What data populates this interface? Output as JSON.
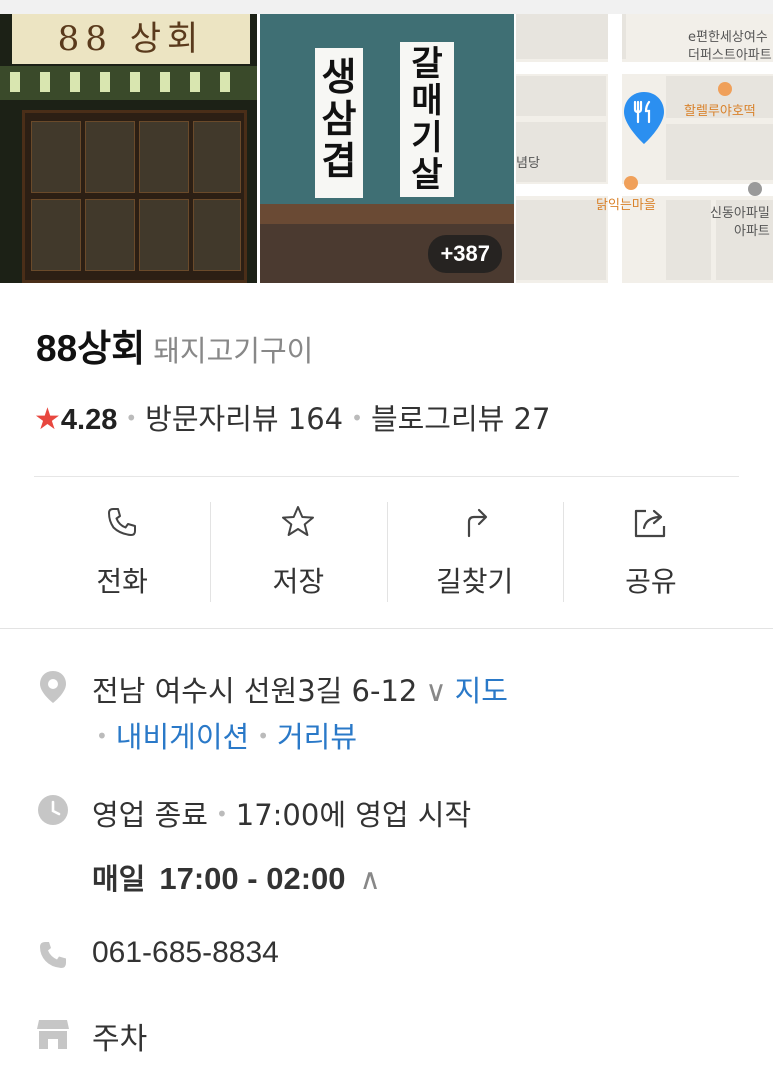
{
  "photos": {
    "store_sign_text": "88 상회",
    "banner_left_text": "생삼겹",
    "banner_right_text": "갈매기살",
    "more_count": "+387",
    "map_labels": {
      "top_right_1": "e편한세상여수",
      "top_right_2": "더퍼스트아파트",
      "orange_1": "할렐루야호떡",
      "left_edge": "념당",
      "orange_2": "닭익는마을",
      "right_1": "신동아파밀",
      "right_2": "아파트"
    }
  },
  "place": {
    "name": "88상회",
    "category": "돼지고기구이",
    "rating": "4.28",
    "visitor_reviews": "방문자리뷰 164",
    "blog_reviews": "블로그리뷰 27"
  },
  "actions": {
    "call": "전화",
    "save": "저장",
    "directions": "길찾기",
    "share": "공유"
  },
  "info": {
    "address": "전남 여수시 선원3길 6-12",
    "map_link": "지도",
    "navigation_link": "내비게이션",
    "street_view_link": "거리뷰",
    "status": "영업 종료",
    "status_detail": "17:00에 영업 시작",
    "hours_day": "매일",
    "hours_time": "17:00 - 02:00",
    "phone": "061-685-8834",
    "parking": "주차"
  },
  "colors": {
    "star": "#e8473f",
    "link": "#2a79c8",
    "map_pin": "#2b8ff0",
    "icon_gray": "#c6c6c6"
  }
}
